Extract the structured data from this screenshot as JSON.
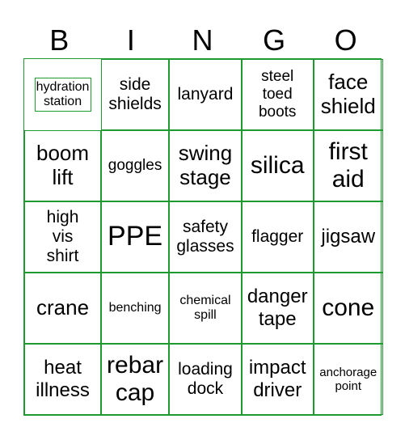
{
  "header": [
    "B",
    "I",
    "N",
    "G",
    "O"
  ],
  "accent_color": "#1e9a2e",
  "cells": [
    "hydration station",
    "side shields",
    "lanyard",
    "steel toed boots",
    "face shield",
    "boom lift",
    "goggles",
    "swing stage",
    "silica",
    "first aid",
    "high vis shirt",
    "PPE",
    "safety glasses",
    "flagger",
    "jigsaw",
    "crane",
    "benching",
    "chemical spill",
    "danger tape",
    "cone",
    "heat illness",
    "rebar cap",
    "loading dock",
    "impact driver",
    "anchorage point"
  ]
}
